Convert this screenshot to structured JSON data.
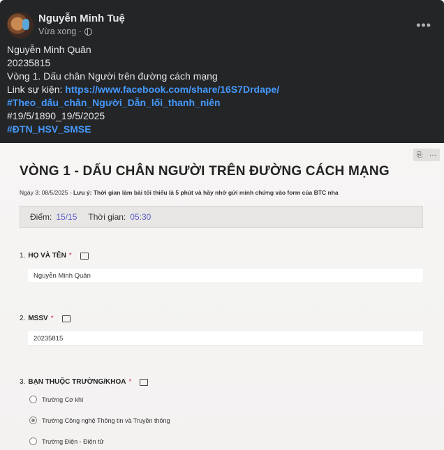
{
  "post": {
    "author": "Nguyễn Minh Tuệ",
    "time": "Vừa xong ·",
    "privacy_icon": "globe-icon",
    "more_icon": "•••",
    "lines": {
      "name": "Nguyễn Minh Quân",
      "id": "20235815",
      "round": "Vòng 1. Dấu chân Người trên đường cách mạng",
      "link_label": "Link sự kiện: ",
      "link_url": "https://www.facebook.com/share/16S7Drdape/",
      "hashtag1": "#Theo_dấu_chân_Người_Dẫn_lối_thanh_niên",
      "date_tag": "#19/5/1890_19/5/2025",
      "hashtag2": "#ĐTN_HSV_SMSE"
    },
    "colors": {
      "bg": "#242526",
      "text": "#e4e6eb",
      "link": "#4599ff"
    }
  },
  "form": {
    "title": "VÒNG 1 - DẤU CHÂN NGƯỜI TRÊN ĐƯỜNG CÁCH MẠNG",
    "desc_prefix": "Ngày 3: 08/5/2025 - ",
    "desc_bold": "Lưu ý: Thời gian làm bài tối thiểu là 5 phút và hãy nhớ gửi minh chứng vào form của BTC nha",
    "score_label": "Điểm:",
    "score_value": "15/15",
    "time_label": "Thời gian:",
    "time_value": "05:30",
    "q1": {
      "num": "1.",
      "label": "HỌ VÀ TÊN",
      "req": "*",
      "answer": "Nguyễn Minh Quân"
    },
    "q2": {
      "num": "2.",
      "label": "MSSV",
      "req": "*",
      "answer": "20235815"
    },
    "q3": {
      "num": "3.",
      "label": "BẠN THUỘC TRƯỜNG/KHOA",
      "req": "*",
      "options": [
        "Trường Cơ khí",
        "Trường Công nghệ Thông tin và Truyền thông",
        "Trường Điện - Điện tử"
      ],
      "selected": "Trường Công nghệ Thông tin và Truyền thông"
    },
    "accent": "#5b5fc7"
  }
}
